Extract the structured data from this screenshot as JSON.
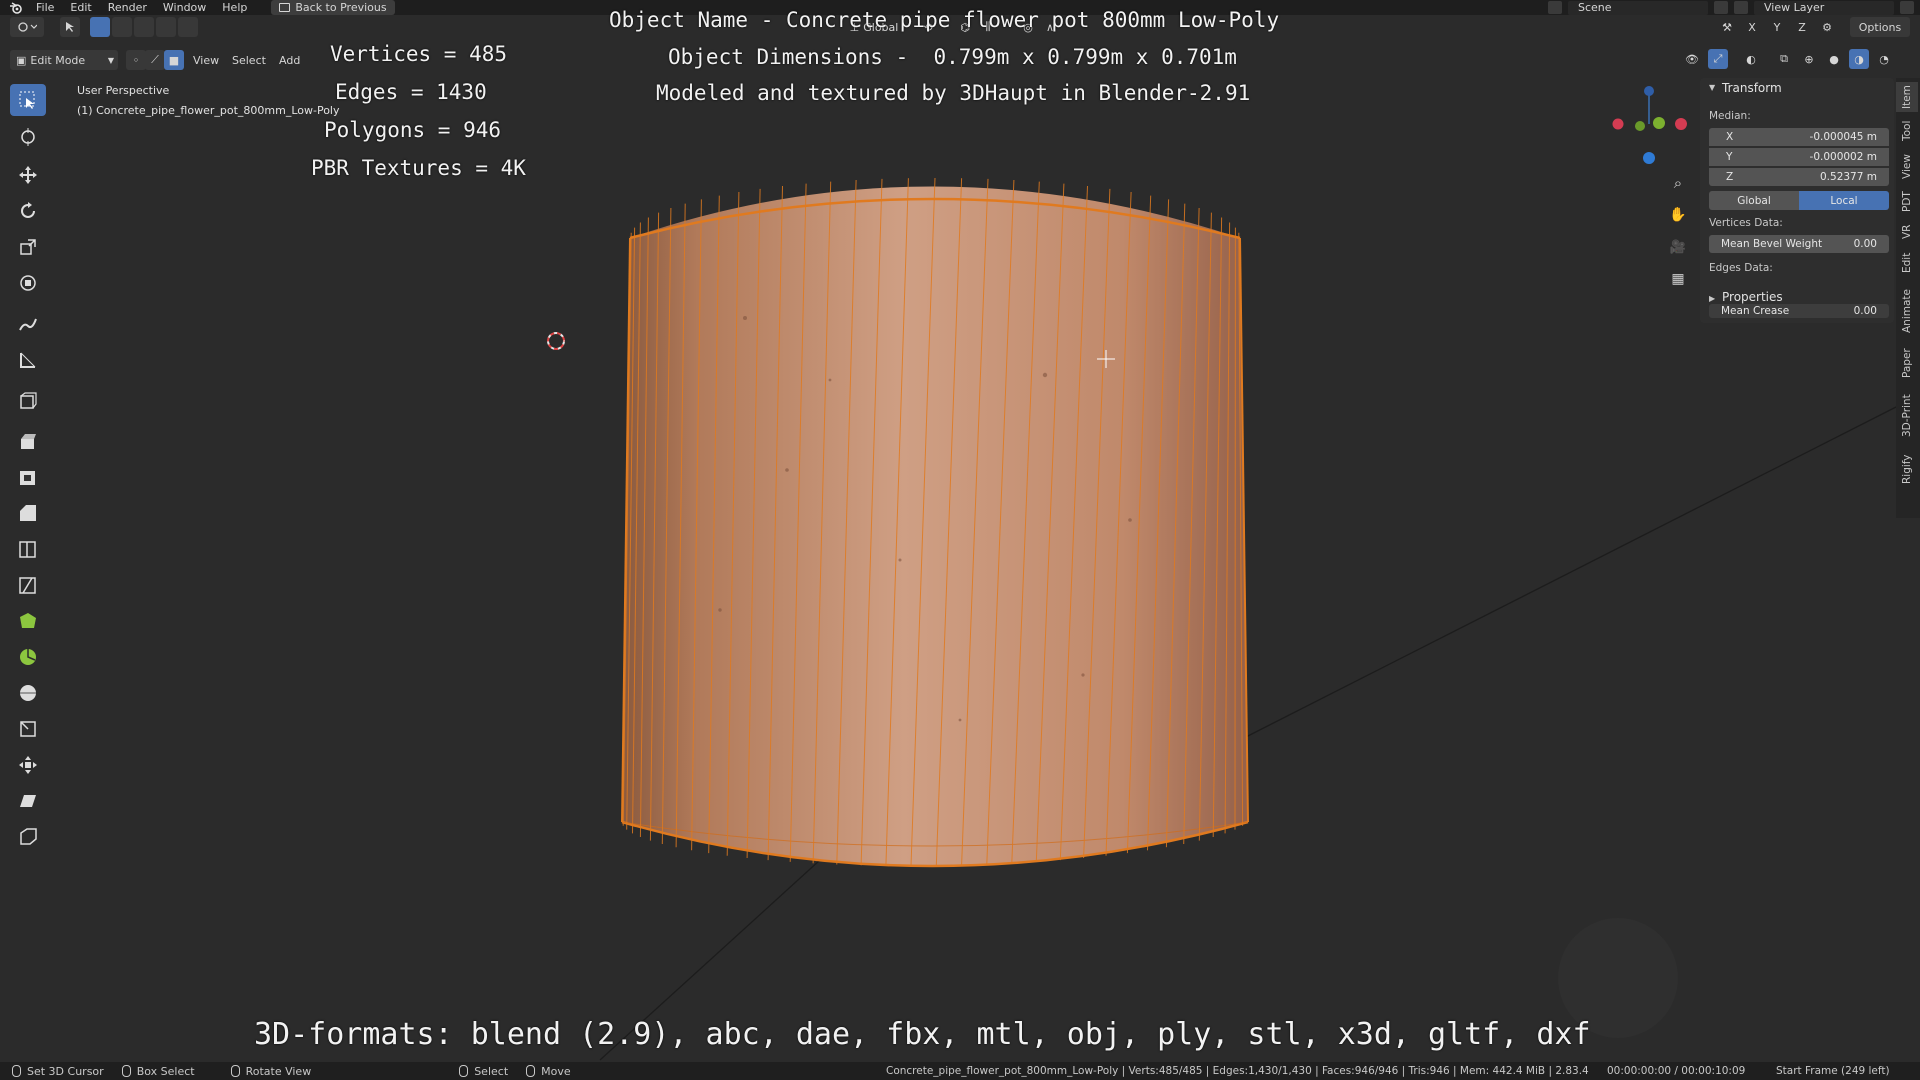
{
  "topbar": {
    "menus": [
      "File",
      "Edit",
      "Render",
      "Window",
      "Help"
    ],
    "back_label": "Back to Previous",
    "scene": "Scene",
    "view_layer": "View Layer"
  },
  "header": {
    "mode": "Edit Mode",
    "menus": [
      "View",
      "Select",
      "Add"
    ],
    "orientation": "Global",
    "options": "Options",
    "axes": [
      "X",
      "Y",
      "Z"
    ]
  },
  "viewport": {
    "perspective": "User Perspective",
    "object_label": "(1) Concrete_pipe_flower_pot_800mm_Low-Poly"
  },
  "overlay": {
    "vertices": "Vertices = 485",
    "edges": "Edges = 1430",
    "polygons": "Polygons = 946",
    "textures": "PBR Textures = 4K",
    "object_name": "Object Name - Concrete pipe flower pot 800mm Low-Poly",
    "dimensions": "Object Dimensions -  0.799m x 0.799m x 0.701m",
    "credit": "Modeled and textured by 3DHaupt in Blender-2.91",
    "formats": "3D-formats: blend (2.9), abc, dae, fbx, mtl, obj, ply, stl, x3d, gltf, dxf"
  },
  "npanel": {
    "transform": "Transform",
    "median": "Median:",
    "x_label": "X",
    "x_value": "-0.000045 m",
    "y_label": "Y",
    "y_value": "-0.000002 m",
    "z_label": "Z",
    "z_value": "0.52377 m",
    "global": "Global",
    "local": "Local",
    "vertices_data": "Vertices Data:",
    "mean_bevel": "Mean Bevel Weight",
    "mean_bevel_value": "0.00",
    "edges_data": "Edges Data:",
    "properties": "Properties",
    "mean_crease": "Mean Crease",
    "mean_crease_value": "0.00"
  },
  "right_tabs": [
    "Item",
    "Tool",
    "View",
    "PDT",
    "VR",
    "Edit",
    "Animate",
    "Paper",
    "3D-Print",
    "Rigify"
  ],
  "statusbar": {
    "set_cursor": "Set 3D Cursor",
    "box_select": "Box Select",
    "rotate_view": "Rotate View",
    "select": "Select",
    "move": "Move",
    "stats": "Concrete_pipe_flower_pot_800mm_Low-Poly | Verts:485/485 | Edges:1,430/1,430 | Faces:946/946 | Tris:946 | Mem: 442.4 MiB | 2.83.4",
    "time": "00:00:00:00 / 00:00:10:09",
    "start_frame": "Start Frame (249 left)"
  },
  "colors": {
    "accent": "#4772b3",
    "mesh_edge": "#e07a1f",
    "background": "#2b2b2b"
  }
}
